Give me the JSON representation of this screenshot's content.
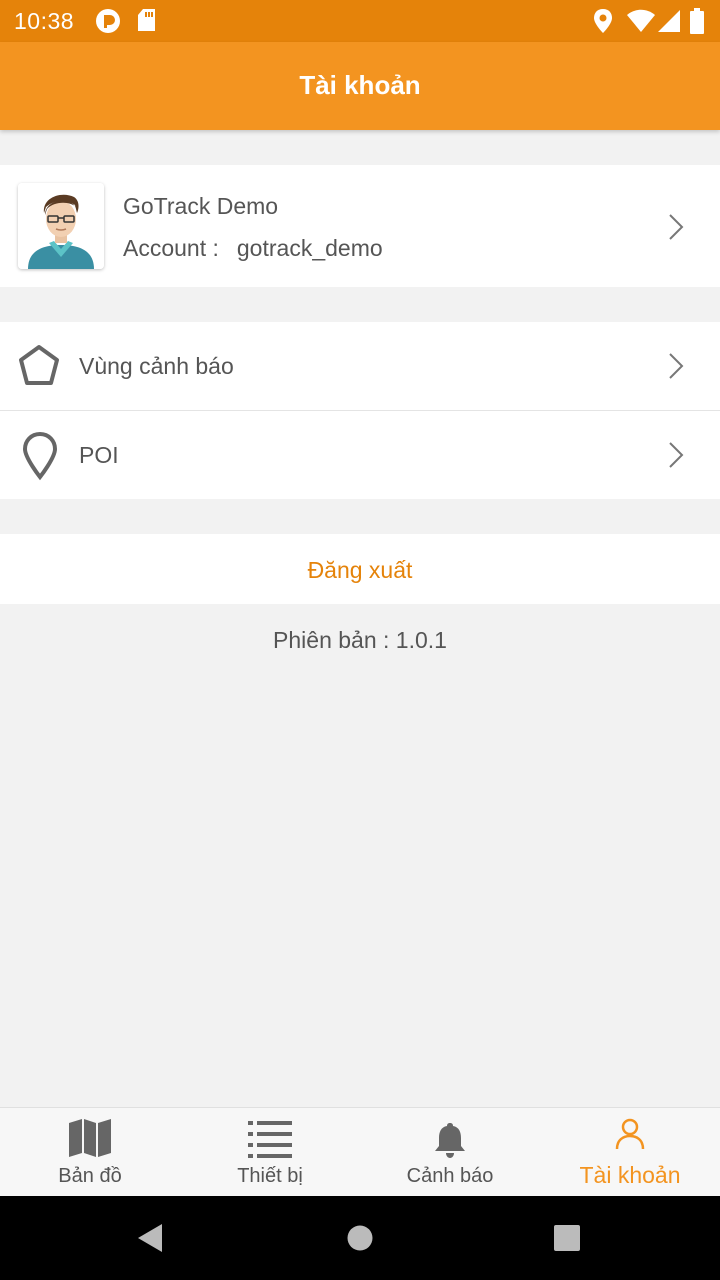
{
  "status_bar": {
    "time": "10:38"
  },
  "app_bar": {
    "title": "Tài khoản"
  },
  "profile": {
    "name": "GoTrack Demo",
    "account_label": "Account :",
    "account_value": "gotrack_demo"
  },
  "menu": {
    "items": [
      {
        "label": "Vùng cảnh báo"
      },
      {
        "label": "POI"
      }
    ]
  },
  "logout": {
    "label": "Đăng xuất"
  },
  "version": {
    "text": "Phiên bản : 1.0.1"
  },
  "tabs": [
    {
      "label": "Bản đồ",
      "icon": "map-icon",
      "active": false
    },
    {
      "label": "Thiết bị",
      "icon": "list-icon",
      "active": false
    },
    {
      "label": "Cảnh báo",
      "icon": "bell-icon",
      "active": false
    },
    {
      "label": "Tài khoản",
      "icon": "user-icon",
      "active": true
    }
  ],
  "colors": {
    "accent": "#f39420",
    "status_bar": "#e5830a",
    "text": "#555555"
  }
}
